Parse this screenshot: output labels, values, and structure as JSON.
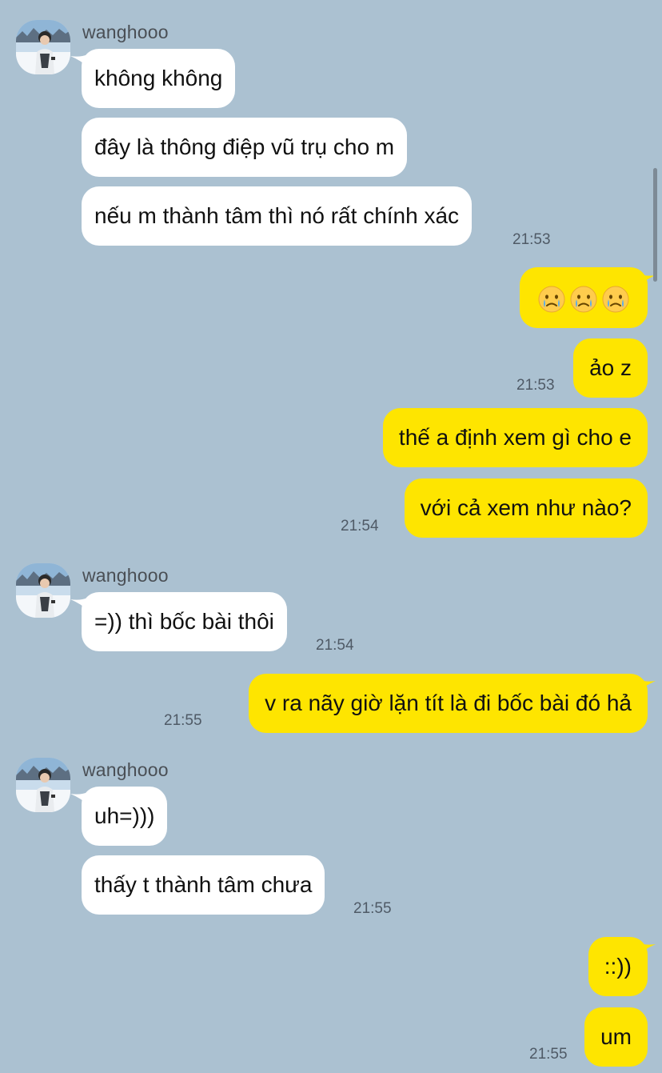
{
  "theme": {
    "background": "#abc1d1",
    "incoming_bubble": "#ffffff",
    "outgoing_bubble": "#fee500"
  },
  "contact": {
    "name": "wanghooo",
    "avatar_icon": "profile-photo-snow-icon"
  },
  "messages": {
    "m1": "không không",
    "m2": "đây là thông điệp vũ trụ cho m",
    "m3": "nếu m thành tâm thì nó rất chính xác",
    "m4_emoji": [
      "crying-face-icon",
      "crying-face-icon",
      "crying-face-icon"
    ],
    "m5": "ảo z",
    "m6": "thế a định xem gì cho e",
    "m7": "với cả xem như nào?",
    "m8": "=)) thì bốc bài thôi",
    "m9": "v ra nãy giờ lặn tít là đi bốc bài đó hả",
    "m10": "uh=)))",
    "m11": "thấy t thành tâm chưa",
    "m12": "::))",
    "m13": "um"
  },
  "times": {
    "t1": "21:53",
    "t2": "21:53",
    "t3": "21:54",
    "t4": "21:54",
    "t5": "21:55",
    "t6": "21:55",
    "t7": "21:55"
  }
}
